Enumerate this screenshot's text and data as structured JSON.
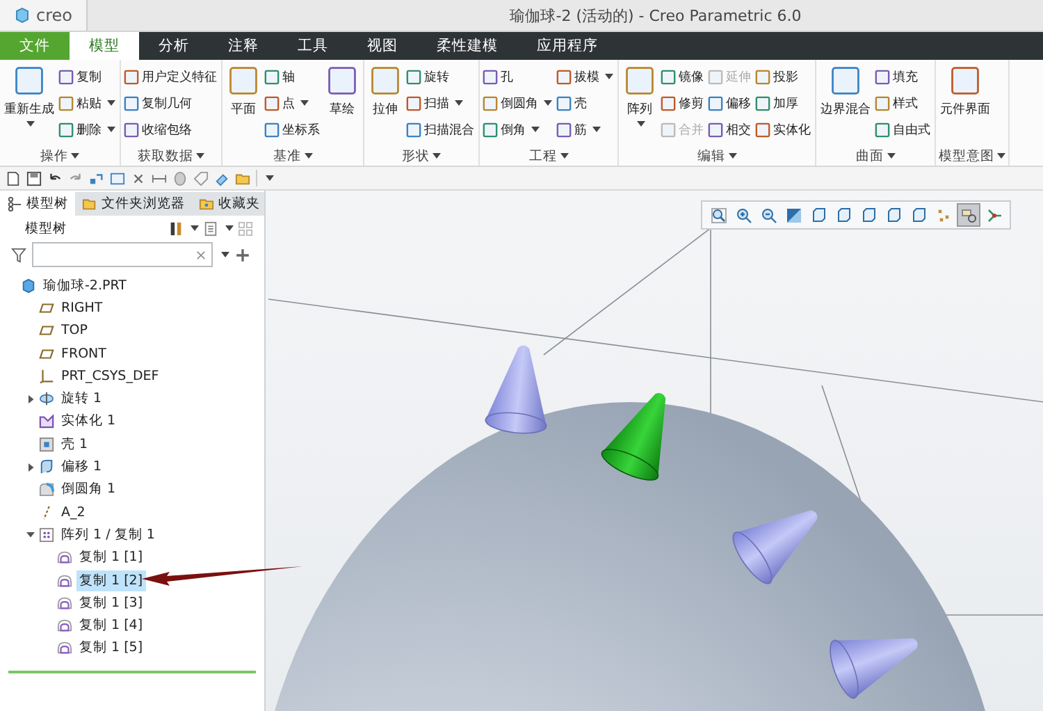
{
  "window": {
    "logo": "creo",
    "title": "瑜伽球-2 (活动的) - Creo Parametric 6.0"
  },
  "tabs": [
    {
      "label": "文件",
      "kind": "file",
      "selected": false
    },
    {
      "label": "模型",
      "kind": "tab",
      "selected": true
    },
    {
      "label": "分析",
      "kind": "tab",
      "selected": false
    },
    {
      "label": "注释",
      "kind": "tab",
      "selected": false
    },
    {
      "label": "工具",
      "kind": "tab",
      "selected": false
    },
    {
      "label": "视图",
      "kind": "tab",
      "selected": false
    },
    {
      "label": "柔性建模",
      "kind": "tab",
      "selected": false
    },
    {
      "label": "应用程序",
      "kind": "tab",
      "selected": false
    }
  ],
  "ribbon": {
    "groups": [
      {
        "label": "操作",
        "columns": [
          [
            {
              "label": "重新生成",
              "kind": "large",
              "has_menu": true,
              "disabled": false
            }
          ],
          [
            {
              "label": "复制",
              "kind": "small",
              "has_menu": false,
              "disabled": false
            },
            {
              "label": "粘贴",
              "kind": "small",
              "has_menu": true,
              "disabled": false
            },
            {
              "label": "删除",
              "kind": "small",
              "has_menu": true,
              "disabled": false
            }
          ]
        ]
      },
      {
        "label": "获取数据",
        "columns": [
          [
            {
              "label": "用户定义特征",
              "kind": "small",
              "has_menu": false,
              "disabled": false
            },
            {
              "label": "复制几何",
              "kind": "small",
              "has_menu": false,
              "disabled": false
            },
            {
              "label": "收缩包络",
              "kind": "small",
              "has_menu": false,
              "disabled": false
            }
          ]
        ]
      },
      {
        "label": "基准",
        "columns": [
          [
            {
              "label": "平面",
              "kind": "large",
              "has_menu": false,
              "disabled": false
            }
          ],
          [
            {
              "label": "轴",
              "kind": "small",
              "has_menu": false,
              "disabled": false
            },
            {
              "label": "点",
              "kind": "small",
              "has_menu": true,
              "disabled": false
            },
            {
              "label": "坐标系",
              "kind": "small",
              "has_menu": false,
              "disabled": false
            }
          ],
          [
            {
              "label": "草绘",
              "kind": "large",
              "has_menu": false,
              "disabled": false
            }
          ]
        ]
      },
      {
        "label": "形状",
        "columns": [
          [
            {
              "label": "拉伸",
              "kind": "large",
              "has_menu": false,
              "disabled": false
            }
          ],
          [
            {
              "label": "旋转",
              "kind": "small",
              "has_menu": false,
              "disabled": false
            },
            {
              "label": "扫描",
              "kind": "small",
              "has_menu": true,
              "disabled": false
            },
            {
              "label": "扫描混合",
              "kind": "small",
              "has_menu": false,
              "disabled": false
            }
          ]
        ]
      },
      {
        "label": "工程",
        "columns": [
          [
            {
              "label": "孔",
              "kind": "small",
              "has_menu": false,
              "disabled": false
            },
            {
              "label": "倒圆角",
              "kind": "small",
              "has_menu": true,
              "disabled": false
            },
            {
              "label": "倒角",
              "kind": "small",
              "has_menu": true,
              "disabled": false
            }
          ],
          [
            {
              "label": "拔模",
              "kind": "small",
              "has_menu": true,
              "disabled": false
            },
            {
              "label": "壳",
              "kind": "small",
              "has_menu": false,
              "disabled": false
            },
            {
              "label": "筋",
              "kind": "small",
              "has_menu": true,
              "disabled": false
            }
          ]
        ]
      },
      {
        "label": "编辑",
        "columns": [
          [
            {
              "label": "阵列",
              "kind": "large",
              "has_menu": true,
              "disabled": false
            }
          ],
          [
            {
              "label": "镜像",
              "kind": "small",
              "has_menu": false,
              "disabled": false
            },
            {
              "label": "修剪",
              "kind": "small",
              "has_menu": false,
              "disabled": false
            },
            {
              "label": "合并",
              "kind": "small",
              "has_menu": false,
              "disabled": true
            }
          ],
          [
            {
              "label": "延伸",
              "kind": "small",
              "has_menu": false,
              "disabled": true
            },
            {
              "label": "偏移",
              "kind": "small",
              "has_menu": false,
              "disabled": false
            },
            {
              "label": "相交",
              "kind": "small",
              "has_menu": false,
              "disabled": false
            }
          ],
          [
            {
              "label": "投影",
              "kind": "small",
              "has_menu": false,
              "disabled": false
            },
            {
              "label": "加厚",
              "kind": "small",
              "has_menu": false,
              "disabled": false
            },
            {
              "label": "实体化",
              "kind": "small",
              "has_menu": false,
              "disabled": false
            }
          ]
        ]
      },
      {
        "label": "曲面",
        "columns": [
          [
            {
              "label": "边界混合",
              "kind": "large",
              "has_menu": false,
              "disabled": false
            }
          ],
          [
            {
              "label": "填充",
              "kind": "small",
              "has_menu": false,
              "disabled": false
            },
            {
              "label": "样式",
              "kind": "small",
              "has_menu": false,
              "disabled": false
            },
            {
              "label": "自由式",
              "kind": "small",
              "has_menu": false,
              "disabled": false
            }
          ]
        ]
      },
      {
        "label": "模型意图",
        "columns": [
          [
            {
              "label": "元件界面",
              "kind": "large",
              "has_menu": false,
              "disabled": false
            }
          ]
        ]
      }
    ]
  },
  "model_tree": {
    "tabs": [
      {
        "label": "模型树",
        "selected": true
      },
      {
        "label": "文件夹浏览器",
        "selected": false
      },
      {
        "label": "收藏夹",
        "selected": false
      }
    ],
    "title": "模型树",
    "items": [
      {
        "label": "瑜伽球-2.PRT",
        "kind": "part",
        "selected": false,
        "children": [
          {
            "label": "RIGHT",
            "kind": "plane",
            "selected": false
          },
          {
            "label": "TOP",
            "kind": "plane",
            "selected": false
          },
          {
            "label": "FRONT",
            "kind": "plane",
            "selected": false
          },
          {
            "label": "PRT_CSYS_DEF",
            "kind": "csys",
            "selected": false
          },
          {
            "label": "旋转 1",
            "kind": "revolve",
            "selected": false,
            "expanded": false
          },
          {
            "label": "实体化 1",
            "kind": "solidify",
            "selected": false
          },
          {
            "label": "壳 1",
            "kind": "shell",
            "selected": false
          },
          {
            "label": "偏移 1",
            "kind": "offset",
            "selected": false,
            "expanded": false
          },
          {
            "label": "倒圆角 1",
            "kind": "round",
            "selected": false
          },
          {
            "label": "A_2",
            "kind": "axis",
            "selected": false
          },
          {
            "label": "阵列 1 / 复制 1",
            "kind": "pattern",
            "selected": false,
            "expanded": true,
            "children": [
              {
                "label": "复制 1 [1]",
                "kind": "copy",
                "selected": false
              },
              {
                "label": "复制 1 [2]",
                "kind": "copy",
                "selected": true
              },
              {
                "label": "复制 1 [3]",
                "kind": "copy",
                "selected": false
              },
              {
                "label": "复制 1 [4]",
                "kind": "copy",
                "selected": false
              },
              {
                "label": "复制 1 [5]",
                "kind": "copy",
                "selected": false
              }
            ]
          }
        ]
      }
    ]
  },
  "view_toolbar": [
    {
      "on": false
    },
    {
      "on": false
    },
    {
      "on": false
    },
    {
      "on": false
    },
    {
      "on": false
    },
    {
      "on": false
    },
    {
      "on": false
    },
    {
      "on": false
    },
    {
      "on": false
    },
    {
      "on": false
    },
    {
      "on": true
    },
    {
      "on": false
    }
  ]
}
